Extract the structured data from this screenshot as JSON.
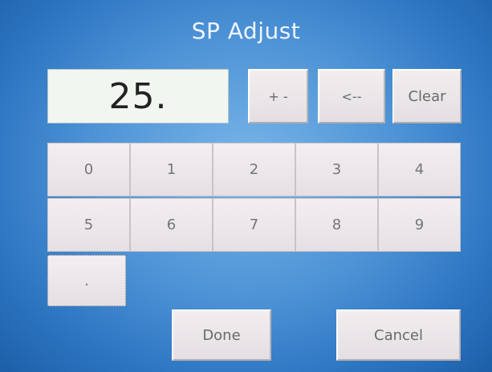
{
  "title": "SP Adjust",
  "display": {
    "value": "25."
  },
  "top_buttons": {
    "sign": "+ -",
    "backspace": "<--",
    "clear": "Clear"
  },
  "keypad": {
    "row1": [
      "0",
      "1",
      "2",
      "3",
      "4"
    ],
    "row2": [
      "5",
      "6",
      "7",
      "8",
      "9"
    ],
    "decimal": "."
  },
  "actions": {
    "done": "Done",
    "cancel": "Cancel"
  },
  "colors": {
    "background": "#4e93d6",
    "key": "#ece7ea",
    "display_bg": "#f1f6f0"
  }
}
